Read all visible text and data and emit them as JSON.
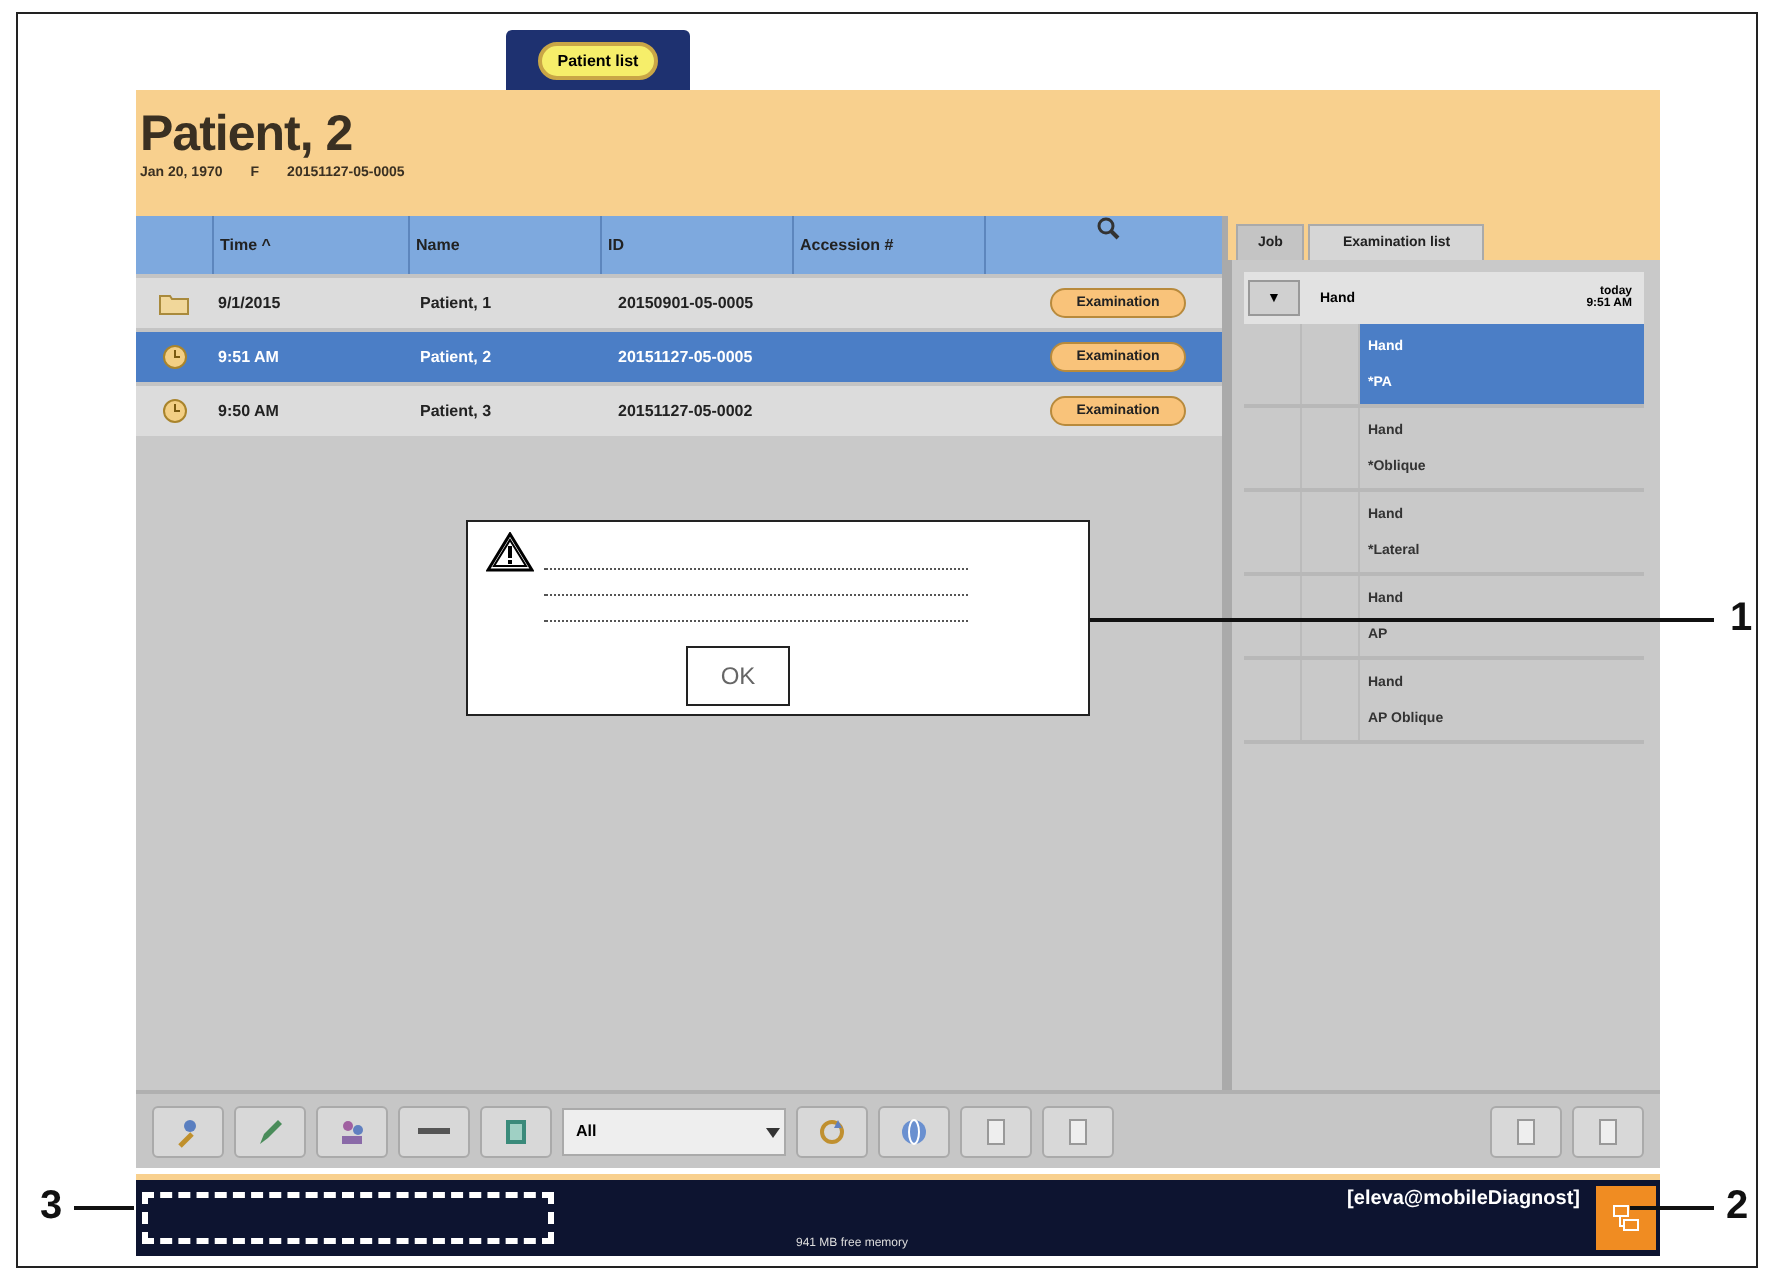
{
  "top_tab": {
    "label": "Patient list"
  },
  "patient": {
    "name": "Patient, 2",
    "birth_date": "Jan 20, 1970",
    "sex": "F",
    "id": "20151127-05-0005"
  },
  "table": {
    "columns": [
      "Time ^",
      "Name",
      "ID",
      "Accession #"
    ],
    "rows": [
      {
        "kind": "folder",
        "time": "9/1/2015",
        "name": "Patient, 1",
        "id": "20150901-05-0005",
        "action": "Examination",
        "selected": false
      },
      {
        "kind": "clock",
        "time": "9:51 AM",
        "name": "Patient, 2",
        "id": "20151127-05-0005",
        "action": "Examination",
        "selected": true
      },
      {
        "kind": "clock",
        "time": "9:50 AM",
        "name": "Patient, 3",
        "id": "20151127-05-0002",
        "action": "Examination",
        "selected": false
      }
    ]
  },
  "right_tabs": [
    {
      "label": "Job",
      "selected": false
    },
    {
      "label": "Examination list",
      "selected": true
    }
  ],
  "exam_header": {
    "toggle": "▼",
    "title": "Hand",
    "date": "today",
    "time": "9:51 AM"
  },
  "exams": [
    {
      "lines": [
        "Hand",
        "*PA"
      ],
      "selected": true
    },
    {
      "lines": [
        "Hand",
        "*Oblique"
      ],
      "selected": false
    },
    {
      "lines": [
        "Hand",
        "*Lateral"
      ],
      "selected": false
    },
    {
      "lines": [
        "Hand",
        "AP"
      ],
      "selected": false
    },
    {
      "lines": [
        "Hand",
        "AP Oblique"
      ],
      "selected": false
    }
  ],
  "dialog": {
    "button": "OK"
  },
  "toolbar": {
    "left": [
      {
        "kind": "person"
      },
      {
        "kind": "pencil"
      },
      {
        "kind": "people"
      },
      {
        "kind": "dash"
      },
      {
        "kind": "film"
      }
    ],
    "dropdown": "All",
    "right_of_dropdown": [
      {
        "kind": "refresh"
      },
      {
        "kind": "globe"
      },
      {
        "kind": "page"
      },
      {
        "kind": "page"
      }
    ],
    "panel": [
      {
        "kind": "page"
      },
      {
        "kind": "page"
      }
    ]
  },
  "status_bar": {
    "memory": "941 MB free memory",
    "user": "[eleva@mobileDiagnost]"
  },
  "callouts": [
    "1",
    "2",
    "3"
  ]
}
